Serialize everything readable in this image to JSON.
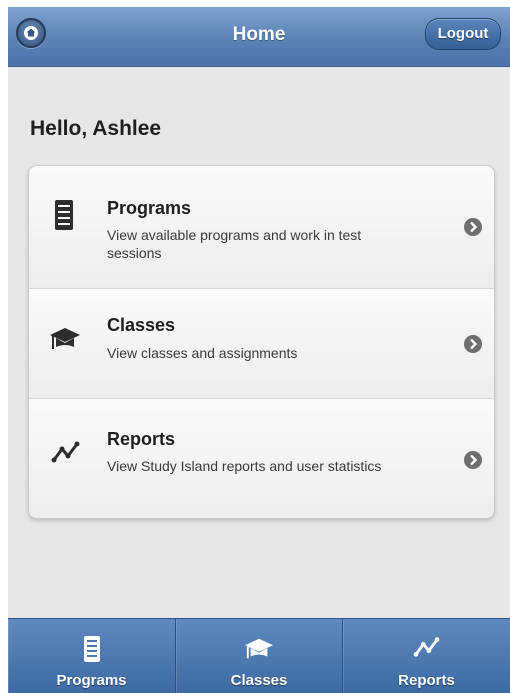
{
  "header": {
    "title": "Home",
    "logout_label": "Logout",
    "home_icon": "home-icon"
  },
  "greeting": "Hello, Ashlee",
  "menu": [
    {
      "icon": "server-stack-icon",
      "title": "Programs",
      "description": "View available programs and work in test sessions"
    },
    {
      "icon": "graduation-cap-icon",
      "title": "Classes",
      "description": "View classes and assignments"
    },
    {
      "icon": "line-graph-icon",
      "title": "Reports",
      "description": "View Study Island reports and user statistics"
    }
  ],
  "tabs": [
    {
      "icon": "server-stack-icon",
      "label": "Programs"
    },
    {
      "icon": "graduation-cap-icon",
      "label": "Classes"
    },
    {
      "icon": "line-graph-icon",
      "label": "Reports"
    }
  ],
  "colors": {
    "header_blue": "#5a82b5",
    "tabbar_blue": "#4c78b0",
    "background": "#e7e7e7"
  }
}
